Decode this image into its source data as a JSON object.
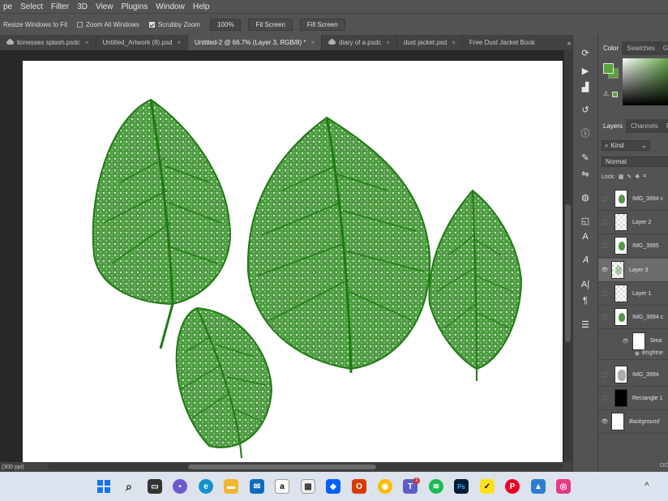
{
  "menu": [
    "pe",
    "Select",
    "Filter",
    "3D",
    "View",
    "Plugins",
    "Window",
    "Help"
  ],
  "options": {
    "resize_windows": "Resize Windows to Fit",
    "zoom_all": "Zoom All Windows",
    "scrubby": "Scrubby Zoom",
    "zoom_value": "100%",
    "fit_screen": "Fit Screen",
    "fill_screen": "Fill Screen"
  },
  "tabs": [
    {
      "label": "lionesses splash.psdc",
      "cloud": true
    },
    {
      "label": "Untitled_Artwork (8).psd",
      "cloud": false
    },
    {
      "label": "Untitled-2 @ 66.7% (Layer 3, RGB/8) *",
      "cloud": false,
      "active": true
    },
    {
      "label": "diary of a.psdc",
      "cloud": true
    },
    {
      "label": "dust jacket.psd",
      "cloud": false
    },
    {
      "label": "Free Dust Jacket Book",
      "cloud": false
    }
  ],
  "tabs_more": "»",
  "status": "(300 ppi)",
  "panel": {
    "color_tab": "Color",
    "swatches_tab": "Swatches",
    "gradients_tab": "Gr",
    "layers_tab": "Layers",
    "channels_tab": "Channels",
    "paths_tab": "P",
    "kind": "Kind",
    "blend": "Normal",
    "lock": "Lock:",
    "footer": "OC"
  },
  "colors": {
    "foreground": "#5aa23b",
    "leaf": "#2d8a1e"
  },
  "layers": [
    {
      "name": "IMG_3994 c",
      "thumb": "leaf",
      "eye": false
    },
    {
      "name": "Layer 2",
      "thumb": "check",
      "eye": false
    },
    {
      "name": "IMG_3995",
      "thumb": "leaf",
      "eye": false
    },
    {
      "name": "Layer 3",
      "thumb": "check",
      "eye": true,
      "selected": true
    },
    {
      "name": "Layer 1",
      "thumb": "check",
      "eye": false
    },
    {
      "name": "IMG_3994 c",
      "thumb": "leaf",
      "eye": false
    },
    {
      "name": "IMG_3994",
      "thumb": "grey",
      "eye": false
    },
    {
      "name": "Rectangle 1",
      "thumb": "black",
      "eye": false
    },
    {
      "name": "Background",
      "thumb": "white",
      "eye": true
    }
  ],
  "smart": {
    "filter": "Sma",
    "brightness": "Brightne"
  },
  "taskbar_icons": [
    "windows-icon",
    "search-icon",
    "task-view-icon",
    "teams-icon",
    "edge-icon",
    "file-explorer-icon",
    "mail-icon",
    "amazon-icon",
    "store-icon",
    "dropbox-icon",
    "office-icon",
    "chrome-icon",
    "teams-work-icon",
    "spotify-icon",
    "photoshop-icon",
    "norton-icon",
    "pinterest-icon",
    "photos-icon",
    "snagit-icon"
  ],
  "badge": "1",
  "tray": "^"
}
